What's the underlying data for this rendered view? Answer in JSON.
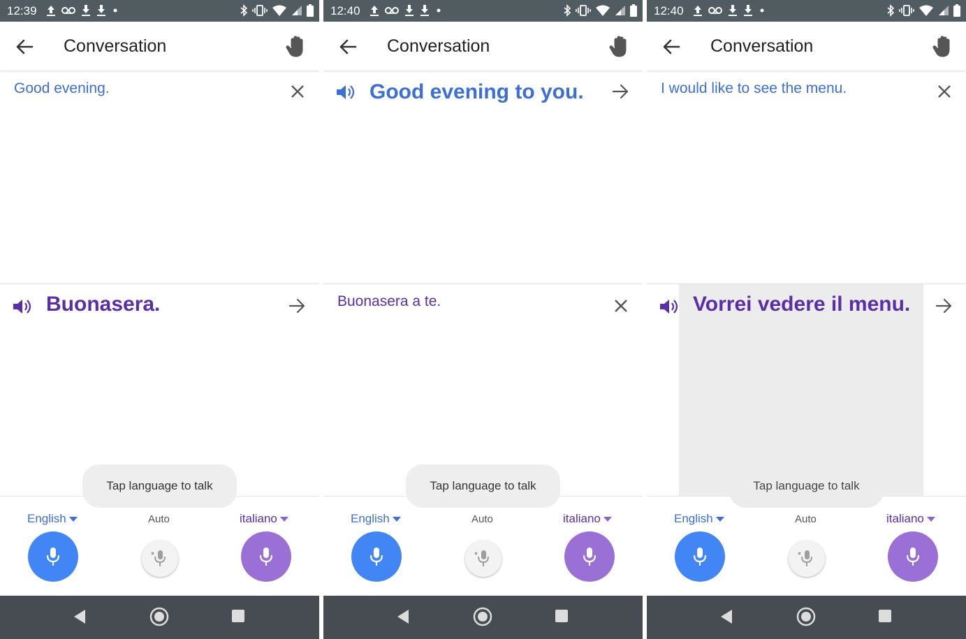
{
  "app": {
    "title": "Conversation"
  },
  "prompts": {
    "toast": "Tap language to talk"
  },
  "languages": {
    "source": "English",
    "target": "italiano",
    "auto": "Auto"
  },
  "colors": {
    "accent_blue": "#3b6fd6",
    "accent_purple": "#5a2ea6",
    "mic_blue": "#4285f4",
    "mic_purple": "#9a6fd6",
    "status_bar": "#505b62",
    "nav_bar": "#464c51"
  },
  "panels": [
    {
      "status_time": "12:39",
      "top": {
        "text": "Good evening.",
        "style": "source",
        "action_icon": "close-icon"
      },
      "bottom": {
        "text": "Buonasera.",
        "style": "translation",
        "action_icon": "arrow-right-icon"
      }
    },
    {
      "status_time": "12:40",
      "top": {
        "text": "Good evening to you.",
        "style": "translation",
        "action_icon": "arrow-right-icon"
      },
      "bottom": {
        "text": "Buonasera a te.",
        "style": "source",
        "action_icon": "close-icon"
      }
    },
    {
      "status_time": "12:40",
      "top": {
        "text": "I would like to see the menu.",
        "style": "source",
        "action_icon": "close-icon"
      },
      "bottom": {
        "text": "Vorrei vedere il menu.",
        "style": "translation",
        "action_icon": "arrow-right-icon",
        "highlighted": true
      }
    }
  ],
  "icons": {
    "status_left": [
      "upload-icon",
      "voicemail-icon",
      "download-icon",
      "download-icon",
      "dot-icon"
    ],
    "status_right": [
      "bluetooth-icon",
      "vibrate-icon",
      "wifi-icon",
      "signal-icon",
      "battery-icon"
    ],
    "appbar": [
      "back-arrow-icon",
      "hand-icon"
    ],
    "mic": [
      "mic-icon",
      "mic-off-icon"
    ],
    "navbar": [
      "nav-back-icon",
      "nav-home-icon",
      "nav-recents-icon"
    ]
  }
}
